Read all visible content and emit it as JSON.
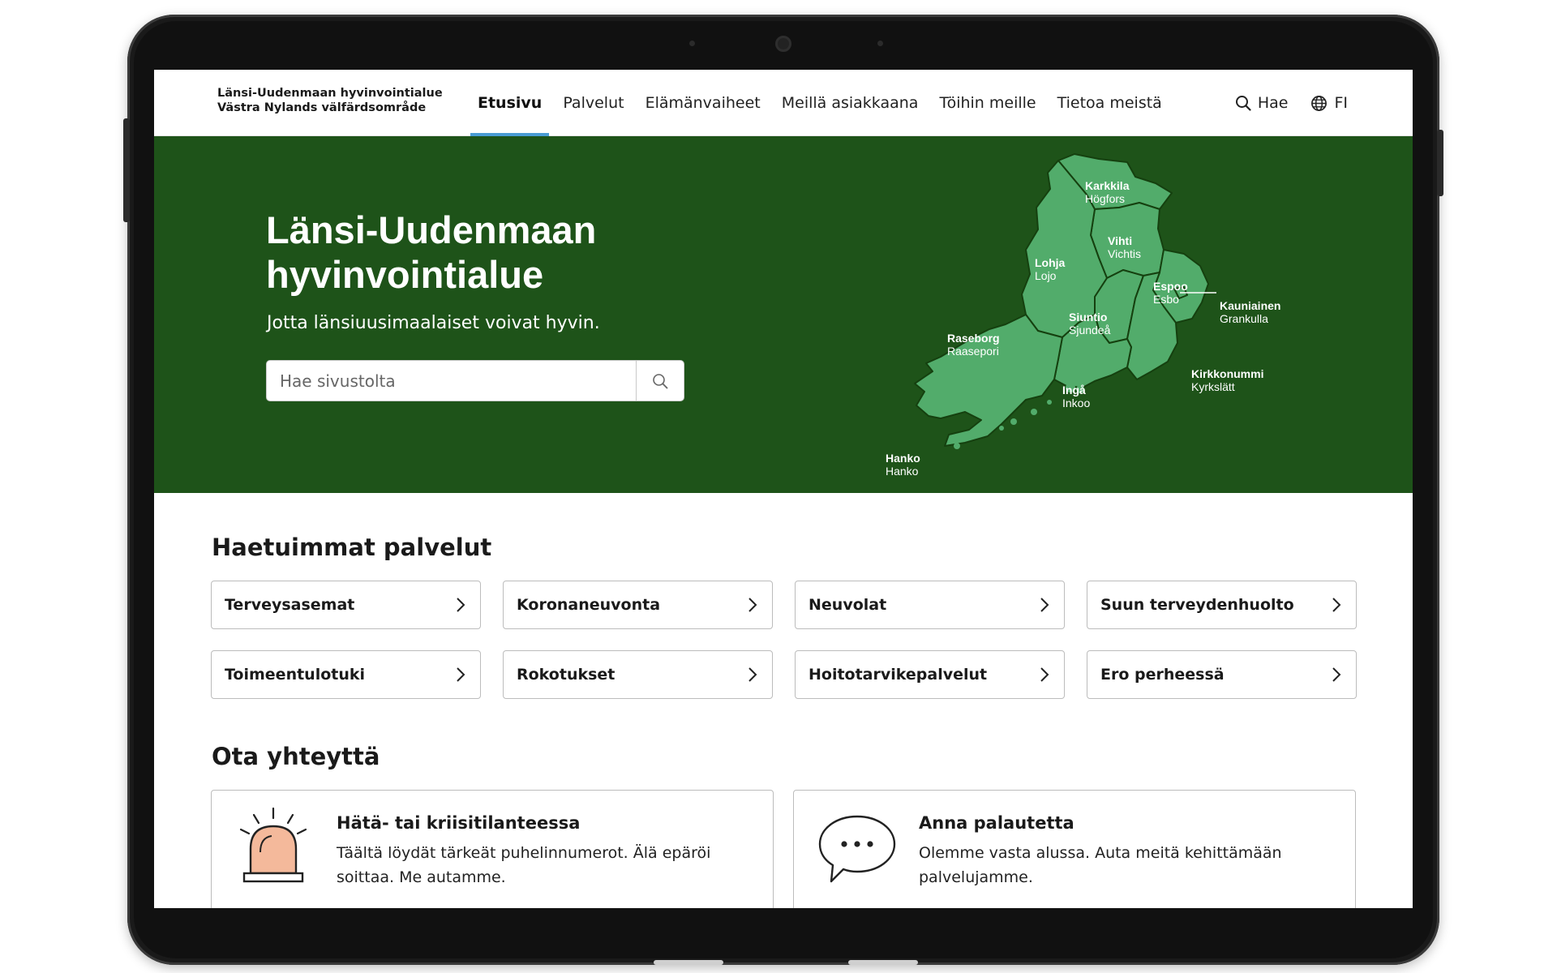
{
  "header": {
    "logo_line1": "Länsi-Uudenmaan hyvinvointialue",
    "logo_line2": "Västra Nylands välfärdsområde",
    "nav": [
      "Etusivu",
      "Palvelut",
      "Elämänvaiheet",
      "Meillä asiakkaana",
      "Töihin meille",
      "Tietoa meistä"
    ],
    "active_nav": "Etusivu",
    "search_label": "Hae",
    "language_label": "FI"
  },
  "hero": {
    "title_line1": "Länsi-Uudenmaan",
    "title_line2": "hyvinvointialue",
    "subtitle": "Jotta länsiuusimaalaiset voivat hyvin.",
    "search_placeholder": "Hae sivustolta",
    "map_labels": [
      {
        "fi": "Karkkila",
        "sv": "Högfors"
      },
      {
        "fi": "Vihti",
        "sv": "Vichtis"
      },
      {
        "fi": "Lohja",
        "sv": "Lojo"
      },
      {
        "fi": "Espoo",
        "sv": "Esbo"
      },
      {
        "fi": "Kauniainen",
        "sv": "Grankulla"
      },
      {
        "fi": "Siuntio",
        "sv": "Sjundeå"
      },
      {
        "fi": "Raseborg",
        "sv": "Raasepori"
      },
      {
        "fi": "Kirkkonummi",
        "sv": "Kyrkslätt"
      },
      {
        "fi": "Ingå",
        "sv": "Inkoo"
      },
      {
        "fi": "Hanko",
        "sv": "Hanko"
      }
    ],
    "map_color": "#52ac6b",
    "bg_color": "#1e5319"
  },
  "services": {
    "title": "Haetuimmat palvelut",
    "items": [
      "Terveysasemat",
      "Koronaneuvonta",
      "Neuvolat",
      "Suun terveydenhuolto",
      "Toimeentulotuki",
      "Rokotukset",
      "Hoitotarvikepalvelut",
      "Ero perheessä"
    ]
  },
  "contact": {
    "title": "Ota yhteyttä",
    "cards": [
      {
        "title": "Hätä- tai kriisitilanteessa",
        "text": "Täältä löydät tärkeät puhelinnumerot. Älä epäröi soittaa. Me autamme.",
        "icon": "alarm-light-icon"
      },
      {
        "title": "Anna palautetta",
        "text": "Olemme vasta alussa. Auta meitä kehittämään palvelujamme.",
        "icon": "speech-bubble-icon"
      }
    ]
  }
}
